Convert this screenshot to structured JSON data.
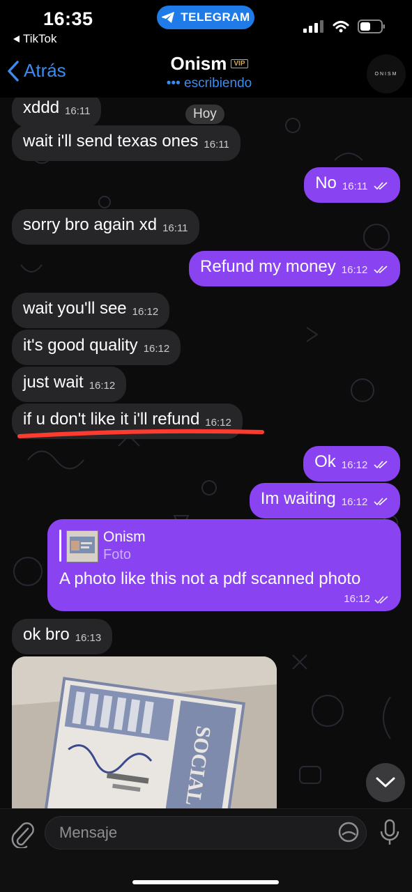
{
  "status_bar": {
    "time": "16:35",
    "back_app": "TikTok",
    "pill_label": "TELEGRAM",
    "icons": [
      "signal-icon",
      "wifi-icon",
      "battery-icon"
    ]
  },
  "header": {
    "back_label": "Atrás",
    "title": "Onism",
    "badge": "VIP",
    "status": "••• escribiendo",
    "avatar_text": "ONISM"
  },
  "chat": {
    "date_chip": "Hoy",
    "messages": [
      {
        "dir": "in",
        "text": "xddd",
        "time": "16:11"
      },
      {
        "dir": "in",
        "text": "wait i'll send texas ones",
        "time": "16:11"
      },
      {
        "dir": "out",
        "text": "No",
        "time": "16:11"
      },
      {
        "dir": "in",
        "text": "sorry bro again xd",
        "time": "16:11"
      },
      {
        "dir": "out",
        "text": "Refund my money",
        "time": "16:12"
      },
      {
        "dir": "in",
        "text": "wait you'll see",
        "time": "16:12"
      },
      {
        "dir": "in",
        "text": "it's good quality",
        "time": "16:12"
      },
      {
        "dir": "in",
        "text": "just wait",
        "time": "16:12"
      },
      {
        "dir": "in",
        "text": "if u don't like it i'll refund",
        "time": "16:12"
      },
      {
        "dir": "out",
        "text": "Ok",
        "time": "16:12"
      },
      {
        "dir": "out",
        "text": "Im waiting",
        "time": "16:12"
      },
      {
        "dir": "in",
        "text": "ok bro",
        "time": "16:13"
      }
    ],
    "reply_message": {
      "quoted_name": "Onism",
      "quoted_kind": "Foto",
      "text": "A photo like this not a pdf scanned photo",
      "time": "16:12"
    },
    "photo_card_text": "SOCIAL",
    "colors": {
      "outgoing": "#8a43f0",
      "incoming": "#262628",
      "accent": "#3b8cf0",
      "underline": "#ff3b30"
    }
  },
  "composer": {
    "placeholder": "Mensaje"
  }
}
